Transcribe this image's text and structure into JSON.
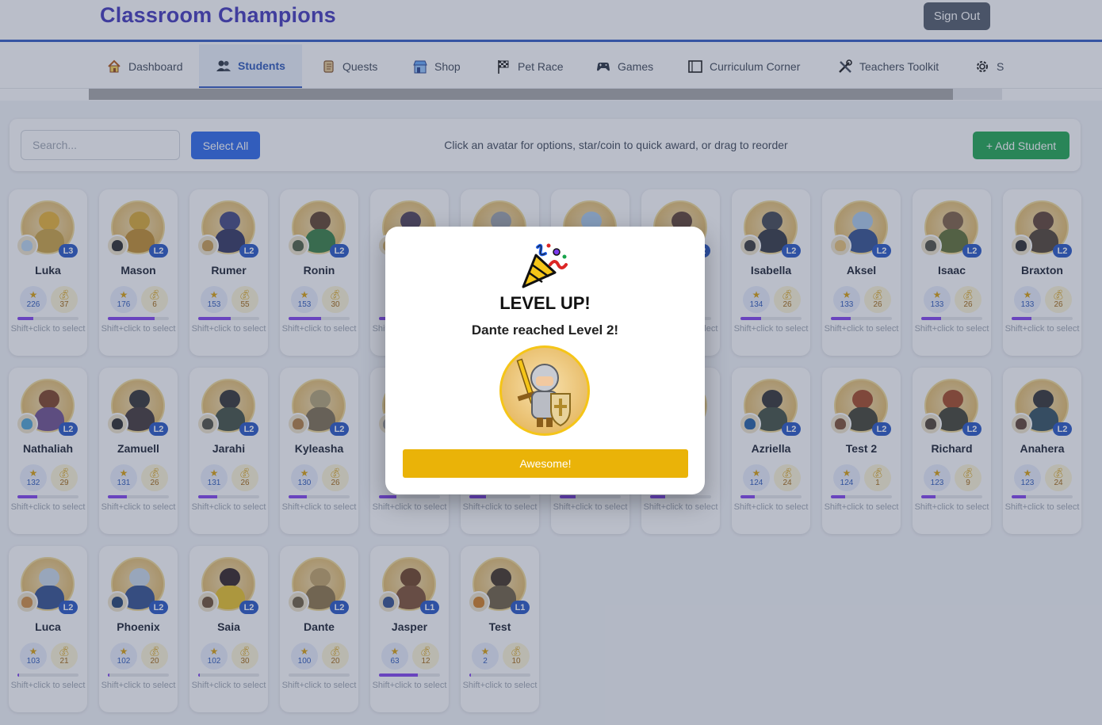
{
  "app": {
    "title": "Classroom Champions",
    "sign_out": "Sign Out"
  },
  "tabs": [
    {
      "label": "Dashboard",
      "icon": "home-icon"
    },
    {
      "label": "Students",
      "icon": "users-icon",
      "active": true
    },
    {
      "label": "Quests",
      "icon": "scroll-icon"
    },
    {
      "label": "Shop",
      "icon": "shop-icon"
    },
    {
      "label": "Pet Race",
      "icon": "flag-icon"
    },
    {
      "label": "Games",
      "icon": "gamepad-icon"
    },
    {
      "label": "Curriculum Corner",
      "icon": "book-icon"
    },
    {
      "label": "Teachers Toolkit",
      "icon": "tools-icon"
    },
    {
      "label": "S",
      "icon": "gear-icon"
    }
  ],
  "toolbar": {
    "search_placeholder": "Search...",
    "select_all": "Select All",
    "hint": "Click an avatar for options, star/coin to quick award, or drag to reorder",
    "add_student": "+ Add Student"
  },
  "students": [
    {
      "name": "Luka",
      "level": "L3",
      "xp": "226",
      "coins": "37",
      "progress": 0.26
    },
    {
      "name": "Mason",
      "level": "L2",
      "xp": "176",
      "coins": "6",
      "progress": 0.76
    },
    {
      "name": "Rumer",
      "level": "L2",
      "xp": "153",
      "coins": "55",
      "progress": 0.53
    },
    {
      "name": "Ronin",
      "level": "L2",
      "xp": "153",
      "coins": "30",
      "progress": 0.53
    },
    {
      "name": "",
      "level": "",
      "xp": "",
      "coins": "",
      "progress": 0.5
    },
    {
      "name": "",
      "level": "",
      "xp": "",
      "coins": "",
      "progress": 0.45
    },
    {
      "name": "",
      "level": "",
      "xp": "",
      "coins": "",
      "progress": 0.4
    },
    {
      "name": "",
      "level": "L2",
      "xp": "",
      "coins": "",
      "progress": 0.38
    },
    {
      "name": "Isabella",
      "level": "L2",
      "xp": "134",
      "coins": "26",
      "progress": 0.34
    },
    {
      "name": "Aksel",
      "level": "L2",
      "xp": "133",
      "coins": "26",
      "progress": 0.33
    },
    {
      "name": "Isaac",
      "level": "L2",
      "xp": "133",
      "coins": "26",
      "progress": 0.33
    },
    {
      "name": "Braxton",
      "level": "L2",
      "xp": "133",
      "coins": "26",
      "progress": 0.33
    },
    {
      "name": "Nathaliah",
      "level": "L2",
      "xp": "132",
      "coins": "29",
      "progress": 0.32
    },
    {
      "name": "Zamuell",
      "level": "L2",
      "xp": "131",
      "coins": "26",
      "progress": 0.31
    },
    {
      "name": "Jarahi",
      "level": "L2",
      "xp": "131",
      "coins": "26",
      "progress": 0.31
    },
    {
      "name": "Kyleasha",
      "level": "L2",
      "xp": "130",
      "coins": "26",
      "progress": 0.3
    },
    {
      "name": "",
      "level": "",
      "xp": "",
      "coins": "",
      "progress": 0.28
    },
    {
      "name": "",
      "level": "",
      "xp": "",
      "coins": "",
      "progress": 0.27
    },
    {
      "name": "",
      "level": "",
      "xp": "",
      "coins": "",
      "progress": 0.26
    },
    {
      "name": "",
      "level": "",
      "xp": "",
      "coins": "",
      "progress": 0.25
    },
    {
      "name": "Azriella",
      "level": "L2",
      "xp": "124",
      "coins": "24",
      "progress": 0.24
    },
    {
      "name": "Test 2",
      "level": "L2",
      "xp": "124",
      "coins": "1",
      "progress": 0.24
    },
    {
      "name": "Richard",
      "level": "L2",
      "xp": "123",
      "coins": "9",
      "progress": 0.23
    },
    {
      "name": "Anahera",
      "level": "L2",
      "xp": "123",
      "coins": "24",
      "progress": 0.23
    },
    {
      "name": "Luca",
      "level": "L2",
      "xp": "103",
      "coins": "21",
      "progress": 0.03
    },
    {
      "name": "Phoenix",
      "level": "L2",
      "xp": "102",
      "coins": "20",
      "progress": 0.02
    },
    {
      "name": "Saia",
      "level": "L2",
      "xp": "102",
      "coins": "30",
      "progress": 0.02
    },
    {
      "name": "Dante",
      "level": "L2",
      "xp": "100",
      "coins": "20",
      "progress": 0.0
    },
    {
      "name": "Jasper",
      "level": "L1",
      "xp": "63",
      "coins": "12",
      "progress": 0.63
    },
    {
      "name": "Test",
      "level": "L1",
      "xp": "2",
      "coins": "10",
      "progress": 0.02
    }
  ],
  "card_hint": "Shift+click to select",
  "modal": {
    "icon": "party-popper-icon",
    "title": "LEVEL UP!",
    "message": "Dante reached Level 2!",
    "button": "Awesome!"
  },
  "colors": {
    "brand": "#3a2fb8",
    "primary": "#2563eb",
    "success": "#16a34a",
    "level_badge": "#1e4fc2",
    "progress": "#7c3aed",
    "award_button": "#eab308"
  }
}
